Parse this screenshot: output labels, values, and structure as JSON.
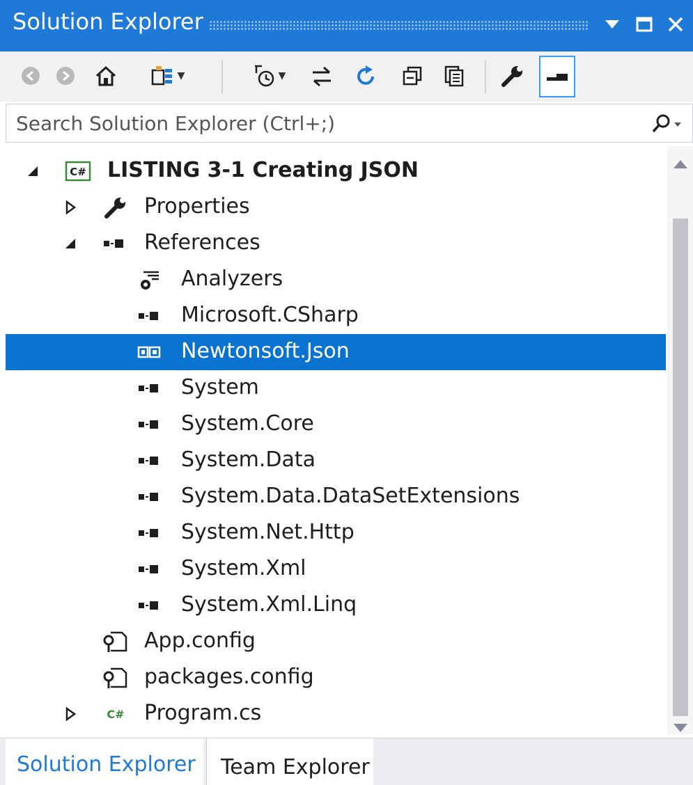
{
  "window": {
    "title": "Solution Explorer",
    "title_buttons": [
      "dropdown-arrow",
      "maximize",
      "close"
    ]
  },
  "toolbar": {
    "buttons": [
      {
        "name": "back",
        "icon": "circle-arrow-left-icon"
      },
      {
        "name": "forward",
        "icon": "circle-arrow-right-icon"
      },
      {
        "name": "home",
        "icon": "home-icon"
      },
      {
        "name": "switch-views",
        "icon": "switch-views-icon",
        "has_dropdown": true
      },
      {
        "name": "pending-changes-filter",
        "icon": "clock-filter-icon",
        "has_dropdown": true
      },
      {
        "name": "sync-with-active-document",
        "icon": "sync-arrows-icon"
      },
      {
        "name": "refresh",
        "icon": "refresh-icon"
      },
      {
        "name": "collapse-all",
        "icon": "collapse-all-icon"
      },
      {
        "name": "show-all-files",
        "icon": "show-all-files-icon"
      },
      {
        "name": "properties",
        "icon": "wrench-icon"
      },
      {
        "name": "preview-selected-items",
        "icon": "preview-icon",
        "pressed": true
      }
    ]
  },
  "search": {
    "placeholder": "Search Solution Explorer (Ctrl+;)"
  },
  "tree": {
    "project": {
      "label": "LISTING 3-1  Creating JSON",
      "icon": "csharp-project-icon",
      "expanded": true
    },
    "properties": {
      "label": "Properties",
      "icon": "wrench-icon",
      "expanded": false
    },
    "references": {
      "label": "References",
      "icon": "references-icon",
      "expanded": true
    },
    "reference_items": [
      {
        "label": "Analyzers",
        "icon": "analyzers-icon"
      },
      {
        "label": "Microsoft.CSharp",
        "icon": "reference-icon"
      },
      {
        "label": "Newtonsoft.Json",
        "icon": "reference-icon",
        "selected": true
      },
      {
        "label": "System",
        "icon": "reference-icon"
      },
      {
        "label": "System.Core",
        "icon": "reference-icon"
      },
      {
        "label": "System.Data",
        "icon": "reference-icon"
      },
      {
        "label": "System.Data.DataSetExtensions",
        "icon": "reference-icon"
      },
      {
        "label": "System.Net.Http",
        "icon": "reference-icon"
      },
      {
        "label": "System.Xml",
        "icon": "reference-icon"
      },
      {
        "label": "System.Xml.Linq",
        "icon": "reference-icon"
      }
    ],
    "files": [
      {
        "label": "App.config",
        "icon": "config-file-icon"
      },
      {
        "label": "packages.config",
        "icon": "config-file-icon"
      },
      {
        "label": "Program.cs",
        "icon": "csharp-file-icon",
        "expandable": true
      }
    ]
  },
  "tabs": [
    {
      "label": "Solution Explorer",
      "active": true
    },
    {
      "label": "Team Explorer",
      "active": false
    }
  ],
  "colors": {
    "accent": "#1e7ad6",
    "selection": "#0a73cf",
    "csharp_green": "#388a34",
    "toolbar_bg": "#f1f1f1"
  }
}
